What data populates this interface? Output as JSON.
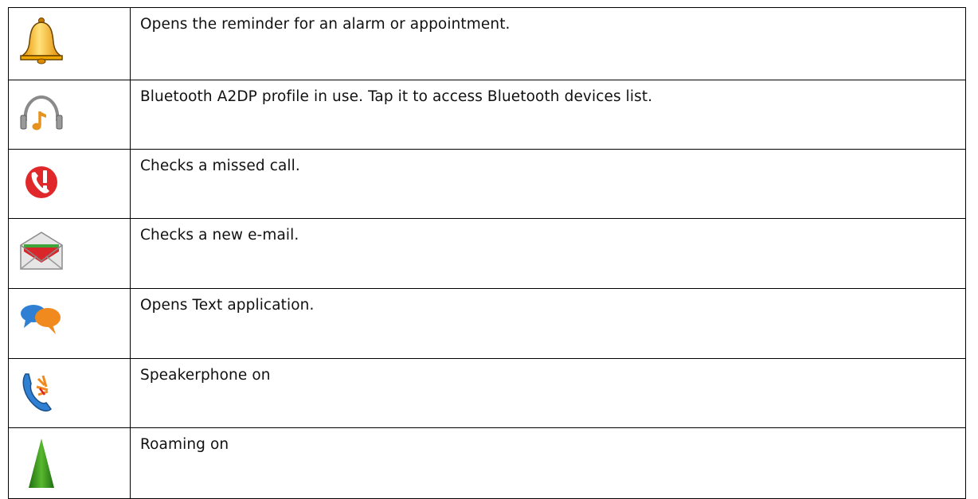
{
  "rows": [
    {
      "icon": "alarm-bell-icon",
      "description": "Opens the reminder for an alarm or appointment."
    },
    {
      "icon": "bluetooth-headphones-icon",
      "description": "Bluetooth A2DP profile in use. Tap it to access Bluetooth devices list."
    },
    {
      "icon": "missed-call-icon",
      "description": "Checks a missed call."
    },
    {
      "icon": "new-email-icon",
      "description": "Checks a new e-mail."
    },
    {
      "icon": "text-messaging-icon",
      "description": "Opens Text application."
    },
    {
      "icon": "speakerphone-icon",
      "description": "Speakerphone on"
    },
    {
      "icon": "roaming-icon",
      "description": "Roaming on"
    }
  ],
  "colors": {
    "border": "#000000",
    "text": "#111111",
    "bell": "#f5b31c",
    "missed_call": "#e0282b",
    "roaming": "#2e8a1a",
    "phone_blue": "#2f7fd3",
    "speaker_orange": "#f08a1e"
  }
}
